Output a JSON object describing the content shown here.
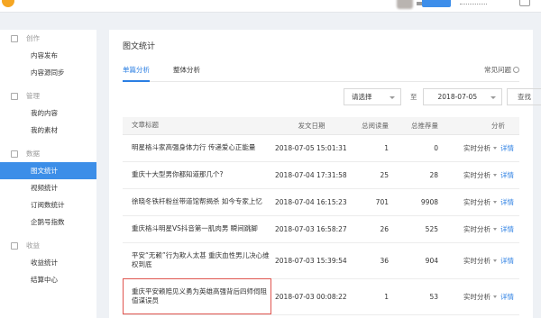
{
  "sidebar": {
    "groups": [
      {
        "title": "创作",
        "items": [
          "内容发布",
          "内容源同步"
        ]
      },
      {
        "title": "管理",
        "items": [
          "我的内容",
          "我的素材"
        ]
      },
      {
        "title": "数据",
        "items": [
          "图文统计",
          "视频统计",
          "订阅数统计",
          "企鹅号指数"
        ]
      },
      {
        "title": "收益",
        "items": [
          "收益统计",
          "结算中心"
        ]
      }
    ]
  },
  "main": {
    "title": "图文统计",
    "tabs": [
      "单篇分析",
      "整体分析"
    ],
    "help": "常见问题",
    "filter": {
      "select": "请选择",
      "sep": "至",
      "date": "2018-07-05",
      "search": "查找"
    },
    "table": {
      "headers": [
        "文章标题",
        "发文日期",
        "总阅读量",
        "总推荐量",
        "分析"
      ],
      "analysis_label": "实时分析",
      "detail_label": "详情",
      "rows": [
        {
          "title": "明星格斗家高强身体力行 传递爱心正能量",
          "date": "2018-07-05 15:01:31",
          "reads": "1",
          "recs": "0"
        },
        {
          "title": "重庆十大型男你都知道那几个?",
          "date": "2018-07-04 17:31:58",
          "reads": "25",
          "recs": "28"
        },
        {
          "title": "徐晓冬铁杆粉丝带道馆帮揭杀 如今专家上忆",
          "date": "2018-07-04 16:15:23",
          "reads": "701",
          "recs": "9908"
        },
        {
          "title": "重庆格斗明星VS抖音第一肌肉男 瞬间跳脚",
          "date": "2018-07-03 16:58:27",
          "reads": "26",
          "recs": "525"
        },
        {
          "title": "平安“无赖”行为欺人太甚 重庆血性男儿决心维权到底",
          "date": "2018-07-03 15:39:54",
          "reads": "36",
          "recs": "904"
        },
        {
          "title": "重庆平安赖赔见义勇为英雄高强背后四师伺阻值谋误员",
          "date": "2018-07-03 00:08:22",
          "reads": "1",
          "recs": "53"
        }
      ]
    }
  },
  "colors": {
    "accent": "#2b7fe3",
    "sidebar_active": "#3c8ee8",
    "highlight": "#e0554f"
  }
}
